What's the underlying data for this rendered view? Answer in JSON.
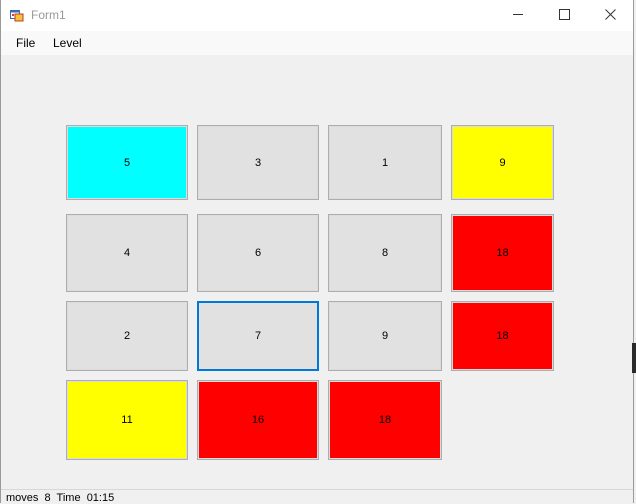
{
  "window": {
    "title": "Form1"
  },
  "menu": {
    "file_label": "File",
    "level_label": "Level"
  },
  "tiles": [
    {
      "value": "5",
      "color": "#00ffff"
    },
    {
      "value": "3",
      "color": "#e1e1e1"
    },
    {
      "value": "1",
      "color": "#e1e1e1"
    },
    {
      "value": "9",
      "color": "#ffff00"
    },
    {
      "value": "4",
      "color": "#e1e1e1"
    },
    {
      "value": "6",
      "color": "#e1e1e1"
    },
    {
      "value": "8",
      "color": "#e1e1e1"
    },
    {
      "value": "18",
      "color": "#ff0000"
    },
    {
      "value": "2",
      "color": "#e1e1e1"
    },
    {
      "value": "7",
      "color": "#e1e1e1"
    },
    {
      "value": "9",
      "color": "#e1e1e1"
    },
    {
      "value": "18",
      "color": "#ff0000"
    },
    {
      "value": "11",
      "color": "#ffff00"
    },
    {
      "value": "16",
      "color": "#ff0000"
    },
    {
      "value": "18",
      "color": "#ff0000"
    }
  ],
  "status": {
    "text": "moves  8  Time  01:15"
  },
  "colors": {
    "accent_focus": "#0078d7",
    "tile_default": "#e1e1e1",
    "cyan": "#00ffff",
    "yellow": "#ffff00",
    "red": "#ff0000"
  },
  "icons": {
    "app": "form-app-icon",
    "minimize": "minimize-icon",
    "maximize": "maximize-icon",
    "close": "close-icon"
  }
}
